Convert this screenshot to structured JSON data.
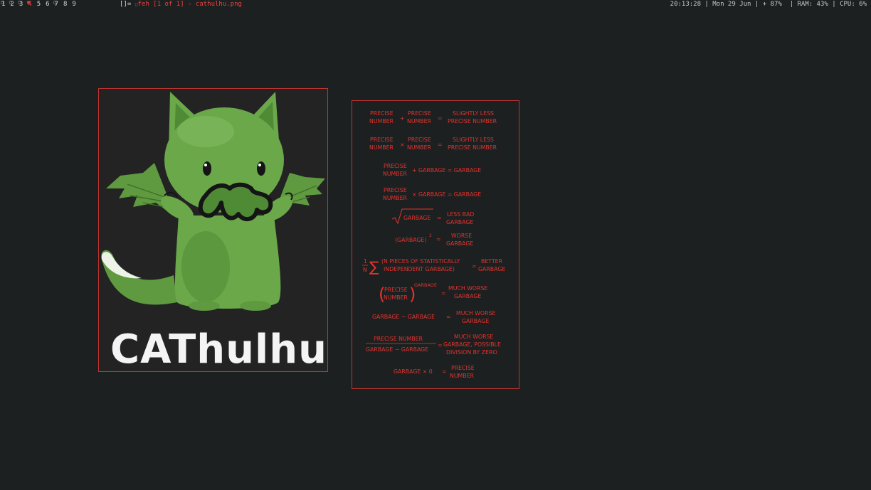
{
  "bar": {
    "tags": [
      {
        "label": "1",
        "marked": true,
        "urgent": false
      },
      {
        "label": "2",
        "marked": true,
        "urgent": false
      },
      {
        "label": "3",
        "marked": true,
        "urgent": false
      },
      {
        "label": "4",
        "marked": true,
        "urgent": true
      },
      {
        "label": "5",
        "marked": false,
        "urgent": false
      },
      {
        "label": "6",
        "marked": false,
        "urgent": false
      },
      {
        "label": "7",
        "marked": true,
        "urgent": false
      },
      {
        "label": "8",
        "marked": false,
        "urgent": false
      },
      {
        "label": "9",
        "marked": false,
        "urgent": false
      }
    ],
    "layout_symbol": "[]=",
    "window_title": "feh [1 of 1] - cathulhu.png",
    "status": "20:13:28 | Mon 29 Jun | + 87%  | RAM: 43% | CPU: 6%"
  },
  "windows": {
    "cathulhu": {
      "caption": "CAThulhu"
    },
    "garbage": {
      "lines": [
        "PRECISE",
        "NUMBER",
        "+",
        "PRECISE",
        "NUMBER",
        "=",
        "SLIGHTLY LESS",
        "PRECISE NUMBER",
        "PRECISE",
        "NUMBER",
        "×",
        "PRECISE",
        "NUMBER",
        "=",
        "SLIGHTLY LESS",
        "PRECISE NUMBER",
        "PRECISE",
        "NUMBER",
        "+ GARBAGE = GARBAGE",
        "PRECISE",
        "NUMBER",
        "× GARBAGE = GARBAGE",
        "GARBAGE",
        "=",
        "LESS BAD",
        "GARBAGE",
        "(GARBAGE)",
        "2",
        "=",
        "WORSE",
        "GARBAGE",
        "1",
        "N",
        "(N PIECES OF STATISTICALLY",
        "INDEPENDENT GARBAGE)",
        "=",
        "BETTER",
        "GARBAGE",
        "PRECISE",
        "NUMBER",
        "GARBAGE",
        "=",
        "MUCH WORSE",
        "GARBAGE",
        "GARBAGE − GARBAGE",
        "=",
        "MUCH WORSE",
        "GARBAGE",
        "PRECISE NUMBER",
        "GARBAGE − GARBAGE",
        "=",
        "MUCH WORSE",
        "GARBAGE, POSSIBLE",
        "DIVISION BY ZERO",
        "GARBAGE × 0",
        "=",
        "PRECISE",
        "NUMBER"
      ]
    }
  },
  "colors": {
    "background": "#1d2021",
    "urgent": "#e8413a",
    "border": "#c23530",
    "cat_green": "#5f9a40"
  }
}
